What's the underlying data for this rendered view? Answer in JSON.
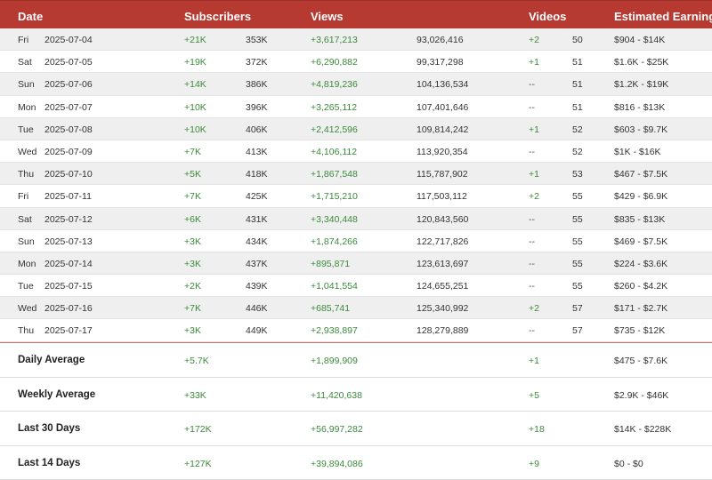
{
  "columns": {
    "date": "Date",
    "subscribers": "Subscribers",
    "views": "Views",
    "videos": "Videos",
    "earnings": "Estimated Earnings"
  },
  "rows": [
    {
      "day": "Fri",
      "date": "2025-07-04",
      "sub_delta": "+21K",
      "subs": "353K",
      "views_delta": "+3,617,213",
      "views": "93,026,416",
      "videos_delta": "+2",
      "videos": "50",
      "earnings": "$904 - $14K"
    },
    {
      "day": "Sat",
      "date": "2025-07-05",
      "sub_delta": "+19K",
      "subs": "372K",
      "views_delta": "+6,290,882",
      "views": "99,317,298",
      "videos_delta": "+1",
      "videos": "51",
      "earnings": "$1.6K - $25K"
    },
    {
      "day": "Sun",
      "date": "2025-07-06",
      "sub_delta": "+14K",
      "subs": "386K",
      "views_delta": "+4,819,236",
      "views": "104,136,534",
      "videos_delta": "--",
      "videos": "51",
      "earnings": "$1.2K - $19K"
    },
    {
      "day": "Mon",
      "date": "2025-07-07",
      "sub_delta": "+10K",
      "subs": "396K",
      "views_delta": "+3,265,112",
      "views": "107,401,646",
      "videos_delta": "--",
      "videos": "51",
      "earnings": "$816 - $13K"
    },
    {
      "day": "Tue",
      "date": "2025-07-08",
      "sub_delta": "+10K",
      "subs": "406K",
      "views_delta": "+2,412,596",
      "views": "109,814,242",
      "videos_delta": "+1",
      "videos": "52",
      "earnings": "$603 - $9.7K"
    },
    {
      "day": "Wed",
      "date": "2025-07-09",
      "sub_delta": "+7K",
      "subs": "413K",
      "views_delta": "+4,106,112",
      "views": "113,920,354",
      "videos_delta": "--",
      "videos": "52",
      "earnings": "$1K - $16K"
    },
    {
      "day": "Thu",
      "date": "2025-07-10",
      "sub_delta": "+5K",
      "subs": "418K",
      "views_delta": "+1,867,548",
      "views": "115,787,902",
      "videos_delta": "+1",
      "videos": "53",
      "earnings": "$467 - $7.5K"
    },
    {
      "day": "Fri",
      "date": "2025-07-11",
      "sub_delta": "+7K",
      "subs": "425K",
      "views_delta": "+1,715,210",
      "views": "117,503,112",
      "videos_delta": "+2",
      "videos": "55",
      "earnings": "$429 - $6.9K"
    },
    {
      "day": "Sat",
      "date": "2025-07-12",
      "sub_delta": "+6K",
      "subs": "431K",
      "views_delta": "+3,340,448",
      "views": "120,843,560",
      "videos_delta": "--",
      "videos": "55",
      "earnings": "$835 - $13K"
    },
    {
      "day": "Sun",
      "date": "2025-07-13",
      "sub_delta": "+3K",
      "subs": "434K",
      "views_delta": "+1,874,266",
      "views": "122,717,826",
      "videos_delta": "--",
      "videos": "55",
      "earnings": "$469 - $7.5K"
    },
    {
      "day": "Mon",
      "date": "2025-07-14",
      "sub_delta": "+3K",
      "subs": "437K",
      "views_delta": "+895,871",
      "views": "123,613,697",
      "videos_delta": "--",
      "videos": "55",
      "earnings": "$224 - $3.6K"
    },
    {
      "day": "Tue",
      "date": "2025-07-15",
      "sub_delta": "+2K",
      "subs": "439K",
      "views_delta": "+1,041,554",
      "views": "124,655,251",
      "videos_delta": "--",
      "videos": "55",
      "earnings": "$260 - $4.2K"
    },
    {
      "day": "Wed",
      "date": "2025-07-16",
      "sub_delta": "+7K",
      "subs": "446K",
      "views_delta": "+685,741",
      "views": "125,340,992",
      "videos_delta": "+2",
      "videos": "57",
      "earnings": "$171 - $2.7K"
    },
    {
      "day": "Thu",
      "date": "2025-07-17",
      "sub_delta": "+3K",
      "subs": "449K",
      "views_delta": "+2,938,897",
      "views": "128,279,889",
      "videos_delta": "--",
      "videos": "57",
      "earnings": "$735 - $12K"
    }
  ],
  "summary": [
    {
      "label": "Daily Average",
      "sub_delta": "+5.7K",
      "views_delta": "+1,899,909",
      "videos_delta": "+1",
      "earnings": "$475 - $7.6K"
    },
    {
      "label": "Weekly Average",
      "sub_delta": "+33K",
      "views_delta": "+11,420,638",
      "videos_delta": "+5",
      "earnings": "$2.9K - $46K"
    },
    {
      "label": "Last 30 Days",
      "sub_delta": "+172K",
      "views_delta": "+56,997,282",
      "videos_delta": "+18",
      "earnings": "$14K - $228K"
    },
    {
      "label": "Last 14 Days",
      "sub_delta": "+127K",
      "views_delta": "+39,894,086",
      "videos_delta": "+9",
      "earnings": "$0 - $0"
    }
  ],
  "colors": {
    "header_bg": "#b73a32",
    "positive": "#3a8a3a",
    "row_alt": "#efefef"
  }
}
